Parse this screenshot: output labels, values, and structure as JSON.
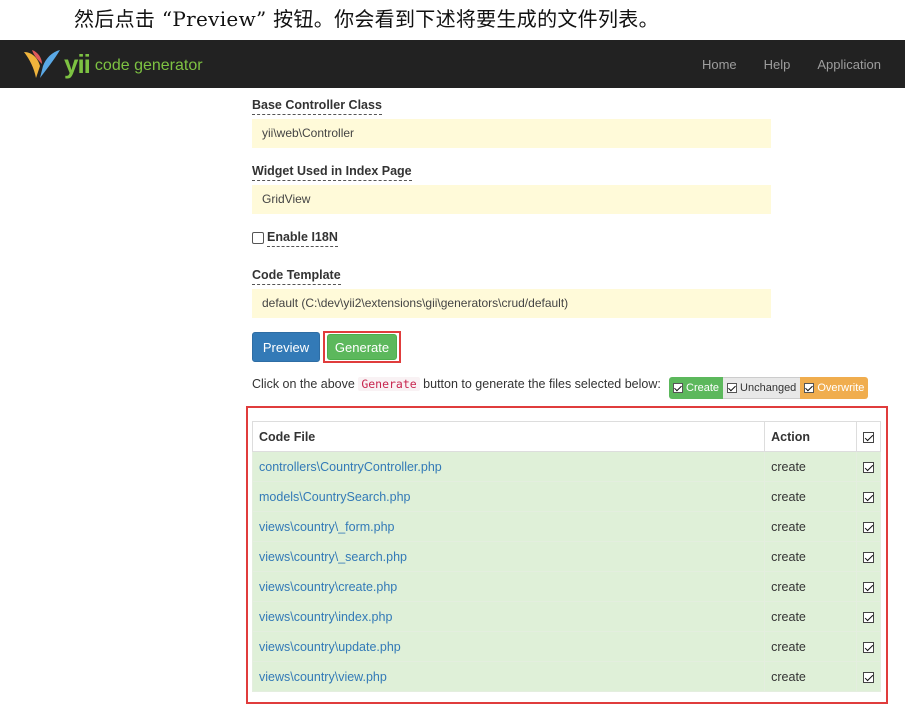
{
  "caption": "然后点击 “Preview” 按钮。你会看到下述将要生成的文件列表。",
  "brand": {
    "logo": "yii",
    "subtitle": "code generator",
    "accent": "#7dc242"
  },
  "nav": [
    {
      "label": "Home"
    },
    {
      "label": "Help"
    },
    {
      "label": "Application"
    }
  ],
  "form": {
    "base_controller": {
      "label": "Base Controller Class",
      "value": "yii\\web\\Controller"
    },
    "widget": {
      "label": "Widget Used in Index Page",
      "value": "GridView"
    },
    "enable_i18n": {
      "label": "Enable I18N",
      "checked": false
    },
    "template": {
      "label": "Code Template",
      "value": "default (C:\\dev\\yii2\\extensions\\gii\\generators\\crud/default)"
    }
  },
  "buttons": {
    "preview": "Preview",
    "generate": "Generate"
  },
  "hint": {
    "prefix": "Click on the above ",
    "code": "Generate",
    "suffix": " button to generate the files selected below:"
  },
  "legend": {
    "create": "Create",
    "unchanged": "Unchanged",
    "overwrite": "Overwrite"
  },
  "table": {
    "headers": {
      "file": "Code File",
      "action": "Action"
    },
    "rows": [
      {
        "file": "controllers\\CountryController.php",
        "action": "create"
      },
      {
        "file": "models\\CountrySearch.php",
        "action": "create"
      },
      {
        "file": "views\\country\\_form.php",
        "action": "create"
      },
      {
        "file": "views\\country\\_search.php",
        "action": "create"
      },
      {
        "file": "views\\country\\create.php",
        "action": "create"
      },
      {
        "file": "views\\country\\index.php",
        "action": "create"
      },
      {
        "file": "views\\country\\update.php",
        "action": "create"
      },
      {
        "file": "views\\country\\view.php",
        "action": "create"
      }
    ]
  }
}
